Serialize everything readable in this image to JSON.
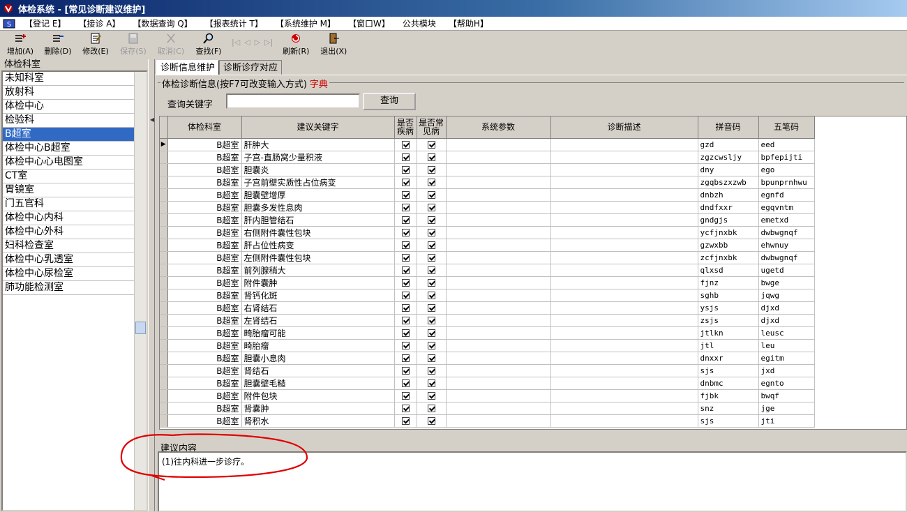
{
  "window": {
    "title": "体检系统 - [常见诊断建议维护]"
  },
  "menu": [
    "【登记 E】",
    "【接诊 A】",
    "【数据查询 Q】",
    "【报表统计 T】",
    "【系统维护 M】",
    "【窗口W】",
    "公共模块",
    "【帮助H】"
  ],
  "toolbar": {
    "add": "增加(A)",
    "delete": "删除(D)",
    "edit": "修改(E)",
    "save": "保存(S)",
    "cancel": "取消(C)",
    "find": "查找(F)",
    "refresh": "刷新(R)",
    "exit": "退出(X)"
  },
  "left": {
    "title": "体检科室",
    "selected_index": 4,
    "items": [
      "未知科室",
      "放射科",
      "体检中心",
      "检验科",
      "B超室",
      "体检中心B超室",
      "体检中心心电图室",
      "CT室",
      "胃镜室",
      "门五官科",
      "体检中心内科",
      "体检中心外科",
      "妇科检查室",
      "体检中心乳透室",
      "体检中心尿检室",
      "肺功能检测室"
    ]
  },
  "tabs": [
    "诊断信息维护",
    "诊断诊疗对应"
  ],
  "group": {
    "title": "体检诊断信息(按F7可改变输入方式)",
    "dict_link": "字典"
  },
  "search": {
    "label": "查询关键字",
    "value": "",
    "button": "查询"
  },
  "grid": {
    "columns": [
      "体检科室",
      "建议关键字",
      "是否疾病",
      "是否常见病",
      "系统参数",
      "诊断描述",
      "拼音码",
      "五笔码"
    ],
    "rows": [
      [
        "B超室",
        "肝肿大",
        true,
        true,
        "",
        "",
        "gzd",
        "eed"
      ],
      [
        "B超室",
        "子宫-直肠窝少量积液",
        true,
        true,
        "",
        "",
        "zgzcwsljy",
        "bpfepijti"
      ],
      [
        "B超室",
        "胆囊炎",
        true,
        true,
        "",
        "",
        "dny",
        "ego"
      ],
      [
        "B超室",
        "子宫前壁实质性占位病变",
        true,
        true,
        "",
        "",
        "zgqbszxzwb",
        "bpunprnhwu"
      ],
      [
        "B超室",
        "胆囊壁增厚",
        true,
        true,
        "",
        "",
        "dnbzh",
        "egnfd"
      ],
      [
        "B超室",
        "胆囊多发性息肉",
        true,
        true,
        "",
        "",
        "dndfxxr",
        "egqvntm"
      ],
      [
        "B超室",
        "肝内胆管结石",
        true,
        true,
        "",
        "",
        "gndgjs",
        "emetxd"
      ],
      [
        "B超室",
        "右侧附件囊性包块",
        true,
        true,
        "",
        "",
        "ycfjnxbk",
        "dwbwgnqf"
      ],
      [
        "B超室",
        "肝占位性病变",
        true,
        true,
        "",
        "",
        "gzwxbb",
        "ehwnuy"
      ],
      [
        "B超室",
        "左侧附件囊性包块",
        true,
        true,
        "",
        "",
        "zcfjnxbk",
        "dwbwgnqf"
      ],
      [
        "B超室",
        "前列腺稍大",
        true,
        true,
        "",
        "",
        "qlxsd",
        "ugetd"
      ],
      [
        "B超室",
        "附件囊肿",
        true,
        true,
        "",
        "",
        "fjnz",
        "bwge"
      ],
      [
        "B超室",
        "肾钙化斑",
        true,
        true,
        "",
        "",
        "sghb",
        "jqwg"
      ],
      [
        "B超室",
        "右肾结石",
        true,
        true,
        "",
        "",
        "ysjs",
        "djxd"
      ],
      [
        "B超室",
        "左肾结石",
        true,
        true,
        "",
        "",
        "zsjs",
        "djxd"
      ],
      [
        "B超室",
        "畸胎瘤可能",
        true,
        true,
        "",
        "",
        "jtlkn",
        "leusc"
      ],
      [
        "B超室",
        "畸胎瘤",
        true,
        true,
        "",
        "",
        "jtl",
        "leu"
      ],
      [
        "B超室",
        "胆囊小息肉",
        true,
        true,
        "",
        "",
        "dnxxr",
        "egitm"
      ],
      [
        "B超室",
        "肾结石",
        true,
        true,
        "",
        "",
        "sjs",
        "jxd"
      ],
      [
        "B超室",
        "胆囊壁毛糙",
        true,
        true,
        "",
        "",
        "dnbmc",
        "egnto"
      ],
      [
        "B超室",
        "附件包块",
        true,
        true,
        "",
        "",
        "fjbk",
        "bwqf"
      ],
      [
        "B超室",
        "肾囊肿",
        true,
        true,
        "",
        "",
        "snz",
        "jge"
      ],
      [
        "B超室",
        "肾积水",
        true,
        true,
        "",
        "",
        "sjs",
        "jti"
      ]
    ]
  },
  "advice": {
    "title": "建议内容",
    "text": "(1)往内科进一步诊疗。"
  },
  "colors": {
    "title_bar": "#0a246a",
    "selection": "#316ac5",
    "annotation": "#e00000"
  }
}
